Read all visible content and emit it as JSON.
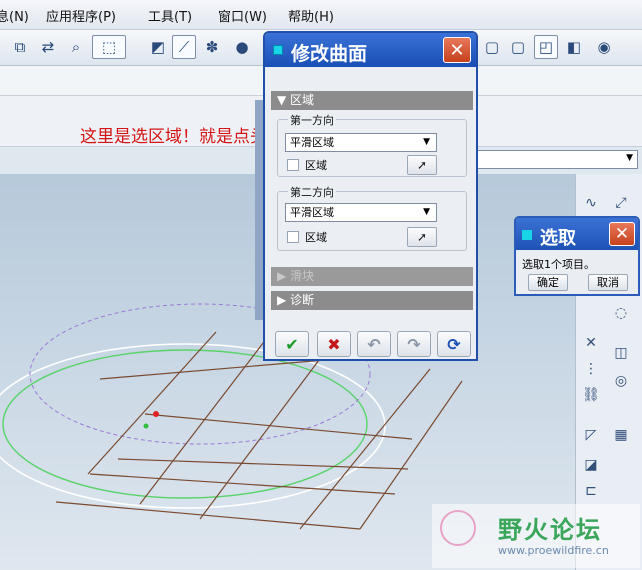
{
  "menu": [
    "息(N)",
    "应用程序(P)",
    "工具(T)",
    "窗口(W)",
    "帮助(H)"
  ],
  "annotation": "这里是选区域！就是点头尾的两两条控制线！",
  "combo_value": "",
  "modify_surface_dialog": {
    "title": "修改曲面",
    "close_label": "✕",
    "region_section": "区域",
    "first_direction": {
      "label": "第一方向",
      "select_value": "平滑区域",
      "checkbox_label": "区域"
    },
    "second_direction": {
      "label": "第二方向",
      "select_value": "平滑区域",
      "checkbox_label": "区域"
    },
    "slider_section": "滑块",
    "diagnosis_section": "诊断",
    "buttons": {
      "ok": "✔",
      "cancel": "✖",
      "undo": "↶",
      "redo": "↷",
      "refresh": "⟳"
    }
  },
  "select_dialog": {
    "title": "选取",
    "close_label": "✕",
    "message": "选取1个项目。",
    "ok_label": "确定",
    "cancel_label": "取消"
  },
  "watermark": {
    "name": "野火论坛",
    "url": "www.proewildfire.cn"
  },
  "colors": {
    "title_bar": "#1a4fb6",
    "annotation": "#d41414",
    "grid": "#7a4a30",
    "ellipse_green": "#59d36a",
    "ellipse_white": "#ffffff"
  }
}
